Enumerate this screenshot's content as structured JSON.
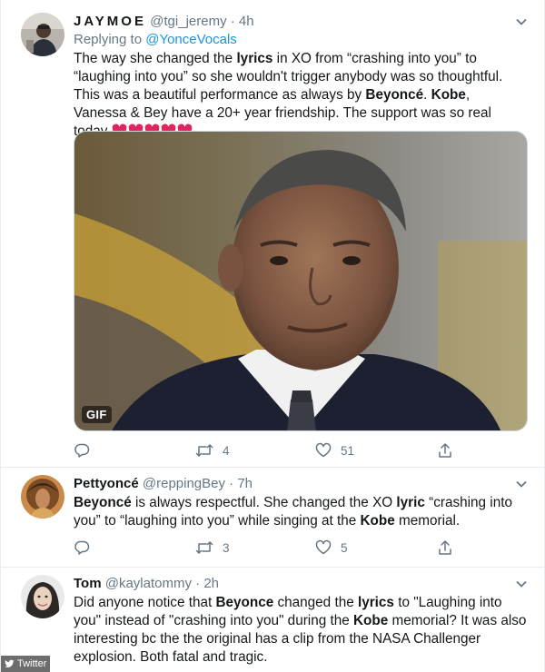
{
  "tweets": [
    {
      "display_name": "JAYMOE",
      "handle": "@tgi_jeremy",
      "separator": "·",
      "time": "4h",
      "replying_prefix": "Replying to ",
      "replying_to": "@YonceVocals",
      "text_segments": [
        "The way she changed the ",
        "lyrics",
        " in XO from “crashing into you” to “laughing into you”  so she wouldn't trigger anybody was so thoughtful. This was a beautiful performance as always by ",
        "Beyoncé",
        ". ",
        "Kobe",
        ", Vanessa & Bey have a 20+ year friendship. The support was so real today "
      ],
      "hearts_count": 5,
      "media_badge": "GIF",
      "replies": "",
      "retweets": "4",
      "likes": "51"
    },
    {
      "display_name": "Pettyoncé",
      "handle": "@reppingBey",
      "separator": "·",
      "time": "7h",
      "text_segments": [
        "Beyoncé",
        " is always respectful. She changed the XO ",
        "lyric",
        " “crashing into you” to “laughing into you” while singing at the ",
        "Kobe",
        " memorial."
      ],
      "replies": "",
      "retweets": "3",
      "likes": "5"
    },
    {
      "display_name": "Tom",
      "handle": "@kaylatommy",
      "separator": "·",
      "time": "2h",
      "text_segments": [
        "Did anyone notice that ",
        "Beyonce",
        " changed the ",
        "lyrics",
        " to \"Laughing into you\" instead of \"crashing into you\" during the ",
        "Kobe",
        " memorial? It was also interesting bc the the original has a clip from the NASA Challenger explosion. Both fatal and tragic."
      ]
    }
  ],
  "watermark": "Twitter",
  "colors": {
    "link": "#1b95e0",
    "secondary_text": "#657786",
    "heart_emoji": "#e0245e",
    "divider": "#e6ecf0"
  },
  "icons": {
    "reply": "reply-icon",
    "retweet": "retweet-icon",
    "like": "heart-outline-icon",
    "share": "share-icon",
    "caret": "chevron-down-icon"
  }
}
